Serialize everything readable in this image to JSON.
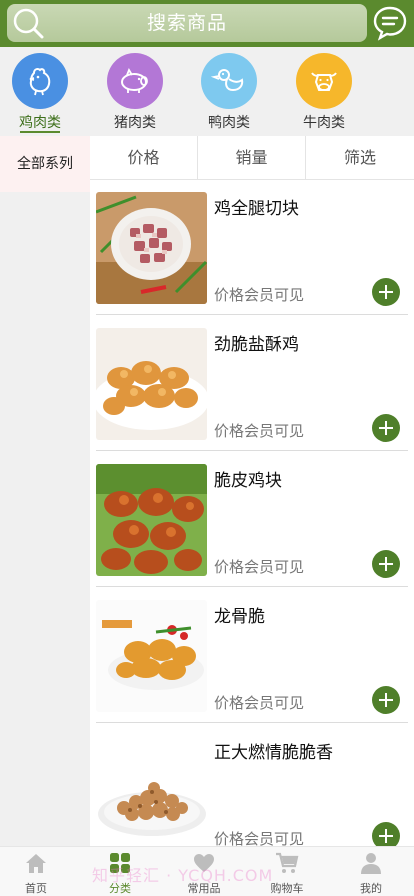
{
  "header": {
    "search_text": "搜索商品"
  },
  "categories": [
    {
      "label": "鸡肉类",
      "icon": "chicken-icon",
      "color": "#4a90e2",
      "active": true
    },
    {
      "label": "猪肉类",
      "icon": "pig-icon",
      "color": "#b377d6",
      "active": false
    },
    {
      "label": "鸭肉类",
      "icon": "duck-icon",
      "color": "#7ec9ef",
      "active": false
    },
    {
      "label": "牛肉类",
      "icon": "cow-icon",
      "color": "#f6b72b",
      "active": false
    }
  ],
  "sidebar": {
    "items": [
      {
        "label": "全部系列",
        "active": true
      }
    ]
  },
  "sort": {
    "price": "价格",
    "sales": "销量",
    "filter": "筛选"
  },
  "products": [
    {
      "name": "鸡全腿切块",
      "price": "价格会员可见"
    },
    {
      "name": "劲脆盐酥鸡",
      "price": "价格会员可见"
    },
    {
      "name": "脆皮鸡块",
      "price": "价格会员可见"
    },
    {
      "name": "龙骨脆",
      "price": "价格会员可见"
    },
    {
      "name": "正大燃情脆脆香",
      "price": "价格会员可见"
    }
  ],
  "tabs": [
    {
      "label": "首页",
      "icon": "home-icon",
      "active": false
    },
    {
      "label": "分类",
      "icon": "category-icon",
      "active": true
    },
    {
      "label": "常用品",
      "icon": "heart-icon",
      "active": false
    },
    {
      "label": "购物车",
      "icon": "cart-icon",
      "active": false
    },
    {
      "label": "我的",
      "icon": "user-icon",
      "active": false
    }
  ],
  "watermark": "知乎轻汇 · YCQH.COM",
  "colors": {
    "brand_green": "#5b8a2e",
    "add_button": "#4f7f2a"
  }
}
